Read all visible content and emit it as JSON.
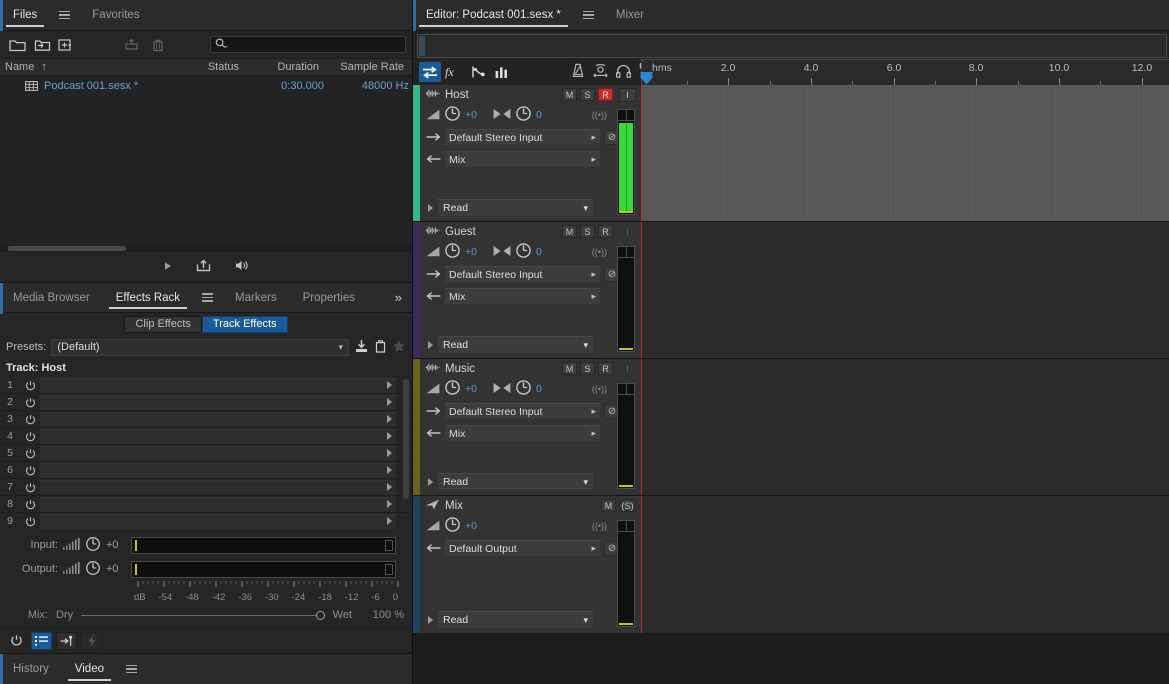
{
  "files_panel": {
    "tabs": [
      {
        "label": "Files",
        "active": true
      },
      {
        "label": "Favorites",
        "active": false
      }
    ],
    "toolbar": [
      {
        "name": "open-file-icon",
        "enabled": true
      },
      {
        "name": "import-folder-icon",
        "enabled": true
      },
      {
        "name": "new-file-icon",
        "enabled": true
      },
      {
        "name": "export-icon",
        "enabled": false
      },
      {
        "name": "delete-icon",
        "enabled": false
      }
    ],
    "search_placeholder": "",
    "columns": [
      "Name",
      "Status",
      "Duration",
      "Sample Rate"
    ],
    "sort_indicator": "↑",
    "rows": [
      {
        "name": "Podcast 001.sesx *",
        "status": "",
        "duration": "0:30.000",
        "sample_rate": "48000 Hz"
      }
    ],
    "transport": [
      "play-icon",
      "insert-into-multitrack-icon",
      "auto-play-icon"
    ]
  },
  "effects_panel": {
    "tabs": [
      {
        "label": "Media Browser",
        "active": false
      },
      {
        "label": "Effects Rack",
        "active": true
      },
      {
        "label": "Markers",
        "active": false
      },
      {
        "label": "Properties",
        "active": false
      }
    ],
    "overflow": "»",
    "subtabs": [
      {
        "label": "Clip Effects",
        "active": false
      },
      {
        "label": "Track Effects",
        "active": true
      }
    ],
    "presets_label": "Presets:",
    "presets_value": "(Default)",
    "presets_actions": [
      "save-preset-icon",
      "delete-preset-icon",
      "favorite-star-icon"
    ],
    "track_label": "Track: Host",
    "slots": [
      "1",
      "2",
      "3",
      "4",
      "5",
      "6",
      "7",
      "8",
      "9"
    ],
    "input_label": "Input:",
    "input_gain": "+0",
    "output_label": "Output:",
    "output_gain": "+0",
    "db_scale": [
      "dB",
      "-54",
      "-48",
      "-42",
      "-36",
      "-30",
      "-24",
      "-18",
      "-12",
      "-6",
      "0"
    ],
    "mix_label": "Mix:",
    "mix_dry": "Dry",
    "mix_wet": "Wet",
    "mix_value": "100 %",
    "bottom_buttons": [
      {
        "name": "power-toggle-icon",
        "active": false,
        "enabled": true
      },
      {
        "name": "effects-list-icon",
        "active": true,
        "enabled": true
      },
      {
        "name": "insert-effect-icon",
        "active": false,
        "enabled": true
      },
      {
        "name": "process-icon",
        "active": false,
        "enabled": false
      }
    ]
  },
  "bottom_panel": {
    "tabs": [
      {
        "label": "History",
        "active": false
      },
      {
        "label": "Video",
        "active": true
      }
    ]
  },
  "editor": {
    "tabs": [
      {
        "label": "Editor: Podcast 001.sesx *",
        "active": true
      },
      {
        "label": "Mixer",
        "active": false
      }
    ],
    "toolbar_left": [
      {
        "name": "move-tool-icon",
        "active": true
      },
      {
        "name": "fx-icon",
        "active": false
      },
      {
        "name": "automation-icon",
        "active": false
      },
      {
        "name": "levels-icon",
        "active": false
      }
    ],
    "toolbar_mid": [
      {
        "name": "metronome-icon"
      },
      {
        "name": "snap-icon"
      },
      {
        "name": "headphones-icon"
      },
      {
        "name": "marker-icon"
      }
    ],
    "ruler": {
      "unit_label": "hms",
      "ticks": [
        "2.0",
        "4.0",
        "6.0",
        "8.0",
        "10.0",
        "12.0"
      ],
      "playhead_time": 0
    },
    "tracks": [
      {
        "name": "Host",
        "color": "#35b88b",
        "type": "audio",
        "buttons": {
          "mute": "M",
          "solo": "S",
          "record": "R",
          "input": "I"
        },
        "record_armed": true,
        "input_enabled": true,
        "volume": "+0",
        "pan": "0",
        "input_route": "Default Stereo Input",
        "output_route": "Mix",
        "automation_mode": "Read",
        "meter_level": 0.82,
        "lane_active": true
      },
      {
        "name": "Guest",
        "color": "#3d2a5e",
        "type": "audio",
        "buttons": {
          "mute": "M",
          "solo": "S",
          "record": "R",
          "input": "I"
        },
        "record_armed": false,
        "input_enabled": false,
        "volume": "+0",
        "pan": "0",
        "input_route": "Default Stereo Input",
        "output_route": "Mix",
        "automation_mode": "Read",
        "meter_level": 0,
        "lane_active": false
      },
      {
        "name": "Music",
        "color": "#6b6418",
        "type": "audio",
        "buttons": {
          "mute": "M",
          "solo": "S",
          "record": "R",
          "input": "I"
        },
        "record_armed": false,
        "input_enabled": false,
        "volume": "+0",
        "pan": "0",
        "input_route": "Default Stereo Input",
        "output_route": "Mix",
        "automation_mode": "Read",
        "meter_level": 0,
        "lane_active": false
      },
      {
        "name": "Mix",
        "color": "#1e4560",
        "type": "master",
        "buttons": {
          "mute": "M",
          "solo": "(S)"
        },
        "record_armed": false,
        "input_enabled": false,
        "volume": "+0",
        "pan": null,
        "input_route": null,
        "output_route": "Default Output",
        "automation_mode": "Read",
        "meter_level": 0,
        "lane_active": false
      }
    ]
  },
  "colors": {
    "accent_blue": "#1a5a96",
    "link_blue": "#6e9fd4",
    "record_red": "#c4302b",
    "meter_green": "#3ad83a",
    "playhead_red": "#b03030",
    "panel_bg": "#252525",
    "header_bg": "#333333"
  }
}
